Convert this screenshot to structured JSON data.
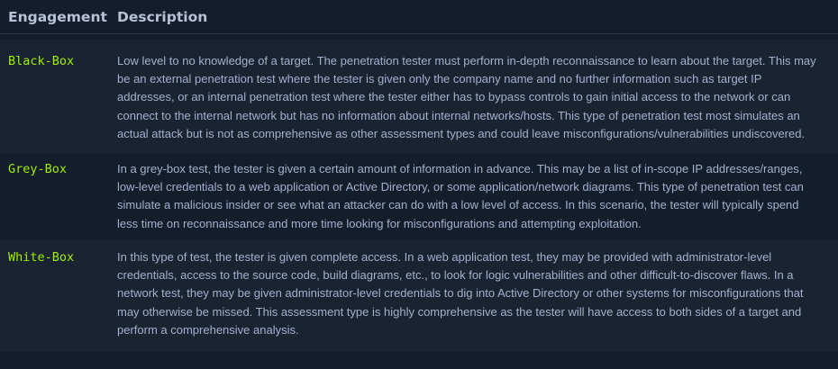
{
  "header": {
    "engagement": "Engagement",
    "description": "Description"
  },
  "rows": [
    {
      "engagement": "Black-Box",
      "description": "Low level to no knowledge of a target. The penetration tester must perform in-depth reconnaissance to learn about the target. This may be an external penetration test where the tester is given only the company name and no further information such as target IP addresses, or an internal penetration test where the tester either has to bypass controls to gain initial access to the network or can connect to the internal network but has no information about internal networks/hosts. This type of penetration test most simulates an actual attack but is not as comprehensive as other assessment types and could leave misconfigurations/vulnerabilities undiscovered."
    },
    {
      "engagement": "Grey-Box",
      "description": "In a grey-box test, the tester is given a certain amount of information in advance. This may be a list of in-scope IP addresses/ranges, low-level credentials to a web application or Active Directory, or some application/network diagrams. This type of penetration test can simulate a malicious insider or see what an attacker can do with a low level of access. In this scenario, the tester will typically spend less time on reconnaissance and more time looking for misconfigurations and attempting exploitation."
    },
    {
      "engagement": "White-Box",
      "description": "In this type of test, the tester is given complete access. In a web application test, they may be provided with administrator-level credentials, access to the source code, build diagrams, etc., to look for logic vulnerabilities and other difficult-to-discover flaws. In a network test, they may be given administrator-level credentials to dig into Active Directory or other systems for misconfigurations that may otherwise be missed. This assessment type is highly comprehensive as the tester will have access to both sides of a target and perform a comprehensive analysis."
    }
  ],
  "colors": {
    "background": "#141d2b",
    "row_alt": "#1a2332",
    "accent": "#9fef00",
    "text": "#a4b1cd"
  }
}
